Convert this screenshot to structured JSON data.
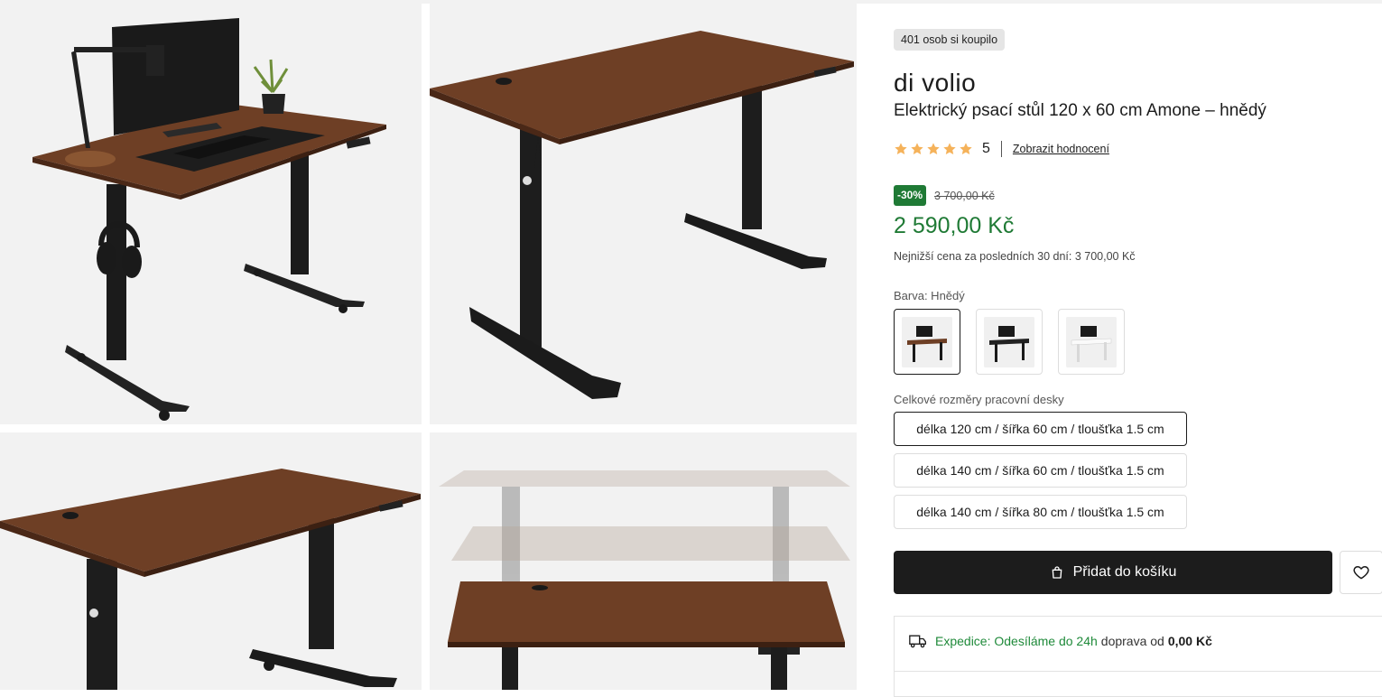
{
  "product": {
    "sold_badge": "401 osob si koupilo",
    "brand": "di volio",
    "title": "Elektrický psací stůl 120 x 60 cm Amone – hnědý",
    "rating": {
      "stars": 5,
      "value": "5",
      "link": "Zobrazit hodnocení"
    },
    "discount": "-30%",
    "old_price": "3 700,00 Kč",
    "price": "2 590,00 Kč",
    "lowest_price": "Nejnižší cena za posledních 30 dní: 3 700,00 Kč",
    "color_label": "Barva: Hnědý",
    "color_options": [
      {
        "name": "Hnědý",
        "selected": true
      },
      {
        "name": "Černý",
        "selected": false
      },
      {
        "name": "Bílý",
        "selected": false
      }
    ],
    "dimensions_label": "Celkové rozměry pracovní desky",
    "dimension_options": [
      {
        "label": "délka 120 cm / šířka 60 cm / tloušťka 1.5 cm",
        "selected": true
      },
      {
        "label": "délka 140 cm / šířka 60 cm / tloušťka 1.5 cm",
        "selected": false
      },
      {
        "label": "délka 140 cm / šířka 80 cm / tloušťka 1.5 cm",
        "selected": false
      }
    ],
    "add_to_cart": "Přidat do košíku",
    "shipping": {
      "highlight": "Expedice: Odesíláme do 24h",
      "text": "doprava od",
      "price": "0,00 Kč"
    }
  },
  "colors": {
    "accent_green": "#1f7a35",
    "button_dark": "#1c1c1c",
    "star": "#f5b25a",
    "wood": "#6e3f25"
  },
  "icons": {
    "cart": "shopping-bag-icon",
    "wishlist": "heart-icon",
    "shipping": "truck-icon"
  }
}
